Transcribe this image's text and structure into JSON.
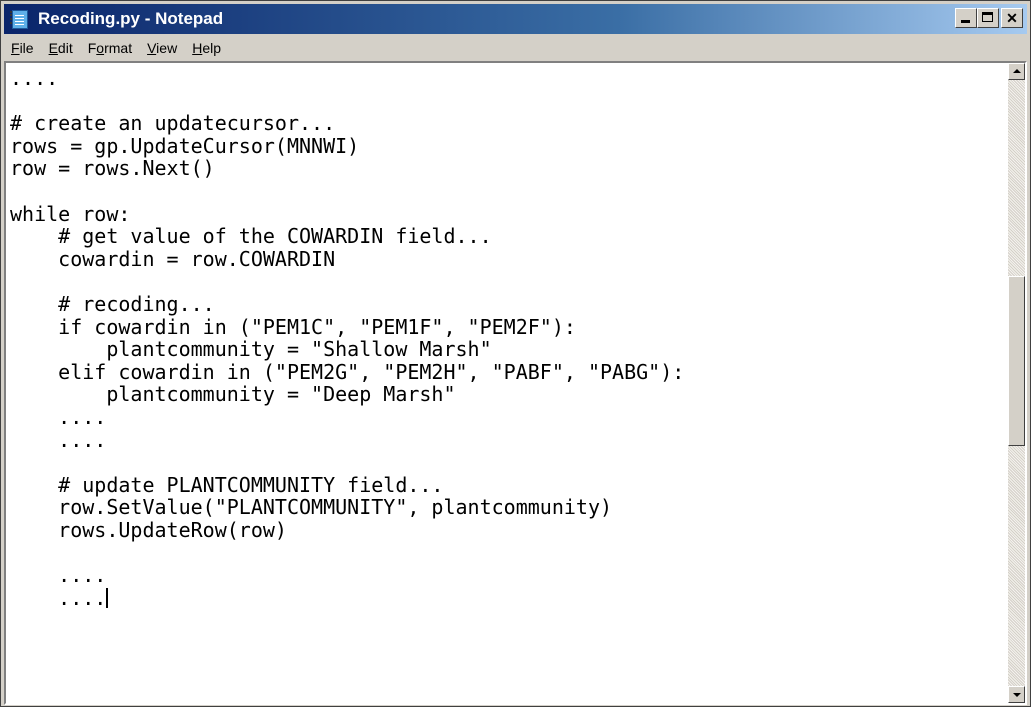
{
  "window": {
    "title": "Recoding.py - Notepad",
    "icon": "notepad-icon",
    "title_bar_color": "#0a246a"
  },
  "menu": [
    {
      "label": "File",
      "mnemonic": "F",
      "rest": "ile"
    },
    {
      "label": "Edit",
      "mnemonic": "E",
      "rest": "dit"
    },
    {
      "label": "Format",
      "pre": "F",
      "mnemonic": "o",
      "rest": "rmat"
    },
    {
      "label": "View",
      "mnemonic": "V",
      "rest": "iew"
    },
    {
      "label": "Help",
      "mnemonic": "H",
      "rest": "elp"
    }
  ],
  "editor": {
    "lines": [
      "....",
      "",
      "# create an updatecursor...",
      "rows = gp.UpdateCursor(MNNWI)",
      "row = rows.Next()",
      "",
      "while row:",
      "    # get value of the COWARDIN field...",
      "    cowardin = row.COWARDIN",
      "",
      "    # recoding...",
      "    if cowardin in (\"PEM1C\", \"PEM1F\", \"PEM2F\"):",
      "        plantcommunity = \"Shallow Marsh\"",
      "    elif cowardin in (\"PEM2G\", \"PEM2H\", \"PABF\", \"PABG\"):",
      "        plantcommunity = \"Deep Marsh\"",
      "    ....",
      "    ....",
      "",
      "    # update PLANTCOMMUNITY field...",
      "    row.SetValue(\"PLANTCOMMUNITY\", plantcommunity)",
      "    rows.UpdateRow(row)",
      "",
      "    ....",
      "    ...."
    ],
    "scroll_position": 0.45
  }
}
